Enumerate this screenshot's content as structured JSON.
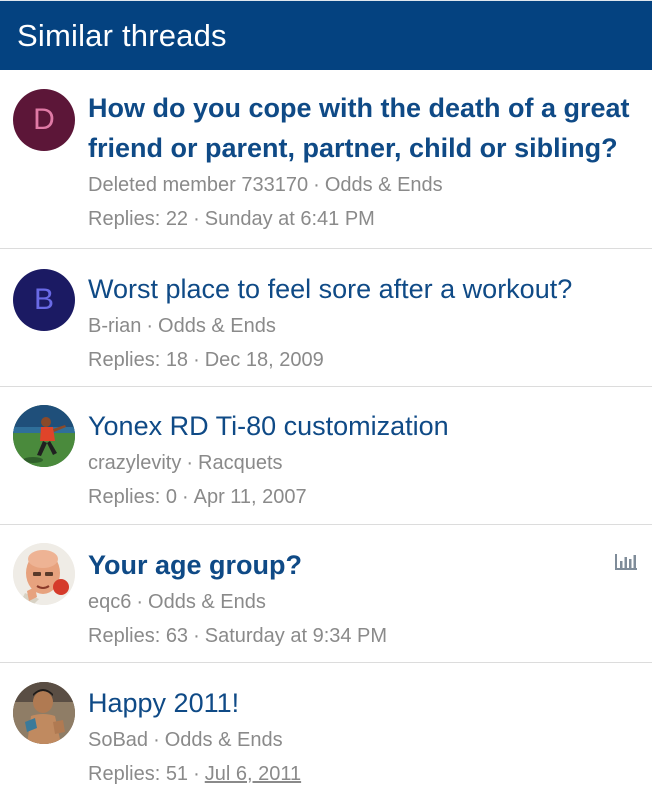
{
  "header": {
    "title": "Similar threads"
  },
  "threads": [
    {
      "title": "How do you cope with the death of a great friend or parent, partner, child or sibling?",
      "author": "Deleted member 733170",
      "forum": "Odds & Ends",
      "replies": "Replies: 22",
      "date": "Sunday at 6:41 PM",
      "avatar": {
        "type": "letter",
        "letter": "D",
        "bg": "#5c1638",
        "fg": "#e07aa6"
      }
    },
    {
      "title": "Worst place to feel sore after a workout?",
      "author": "B-rian",
      "forum": "Odds & Ends",
      "replies": "Replies: 18",
      "date": "Dec 18, 2009",
      "avatar": {
        "type": "letter",
        "letter": "B",
        "bg": "#1b1a63",
        "fg": "#6a6ae6"
      }
    },
    {
      "title": "Yonex RD Ti-80 customization",
      "author": "crazylevity",
      "forum": "Racquets",
      "replies": "Replies: 0",
      "date": "Apr 11, 2007",
      "avatar": {
        "type": "photo",
        "icon": "tennis-player-photo"
      }
    },
    {
      "title": "Your age group?",
      "author": "eqc6",
      "forum": "Odds & Ends",
      "replies": "Replies: 63",
      "date": "Saturday at 9:34 PM",
      "avatar": {
        "type": "photo",
        "icon": "bald-man-photo"
      },
      "poll": true
    },
    {
      "title": "Happy 2011!",
      "author": "SoBad",
      "forum": "Odds & Ends",
      "replies": "Replies: 51",
      "date": "Jul 6, 2011",
      "avatar": {
        "type": "photo",
        "icon": "person-photo"
      }
    }
  ],
  "separator": "·",
  "colors": {
    "header_bg": "#044280",
    "title": "#0f4a86",
    "meta": "#8a8a8a"
  }
}
